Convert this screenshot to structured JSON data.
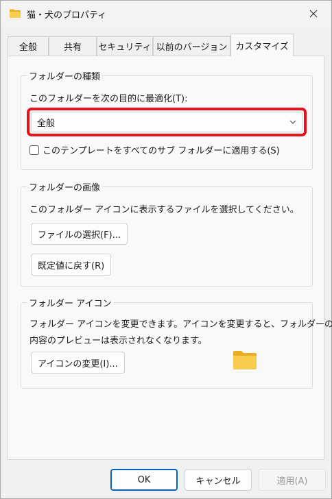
{
  "window": {
    "title": "猫・犬のプロパティ",
    "close_icon": "close-icon"
  },
  "tabs": [
    {
      "label": "全般"
    },
    {
      "label": "共有"
    },
    {
      "label": "セキュリティ"
    },
    {
      "label": "以前のバージョン"
    },
    {
      "label": "カスタマイズ",
      "active": true
    }
  ],
  "folder_type": {
    "title": "フォルダーの種類",
    "optimize_label": "このフォルダーを次の目的に最適化(T):",
    "selected_value": "全般",
    "apply_template_label": "このテンプレートをすべてのサブ フォルダーに適用する(S)",
    "apply_template_checked": false,
    "highlight_color": "#e8121b"
  },
  "folder_image": {
    "title": "フォルダーの画像",
    "description": "このフォルダー アイコンに表示するファイルを選択してください。",
    "choose_file_label": "ファイルの選択(F)...",
    "restore_default_label": "既定値に戻す(R)"
  },
  "folder_icon": {
    "title": "フォルダー アイコン",
    "description_line1": "フォルダー アイコンを変更できます。アイコンを変更すると、フォルダーの",
    "description_line2": "内容のプレビューは表示されなくなります。",
    "change_icon_label": "アイコンの変更(I)..."
  },
  "footer": {
    "ok_label": "OK",
    "cancel_label": "キャンセル",
    "apply_label": "適用(A)",
    "apply_disabled": true
  },
  "colors": {
    "accent": "#005fb8",
    "folder": "#f6c543"
  }
}
